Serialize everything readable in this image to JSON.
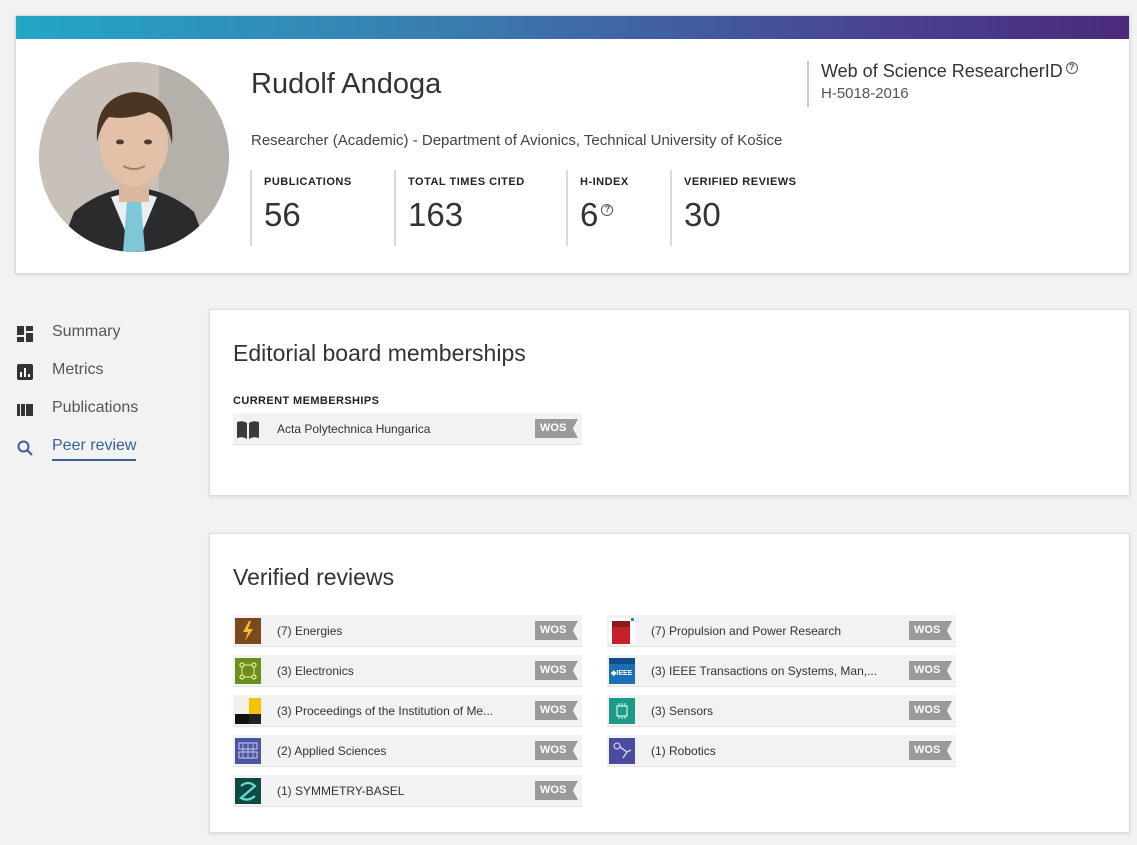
{
  "profile": {
    "name": "Rudolf Andoga",
    "affiliation": "Researcher (Academic) - Department of Avionics, Technical University of Košice",
    "researcher_id_title": "Web of Science ResearcherID",
    "researcher_id": "H-5018-2016",
    "stats": [
      {
        "label": "PUBLICATIONS",
        "value": "56"
      },
      {
        "label": "TOTAL TIMES CITED",
        "value": "163"
      },
      {
        "label": "H-INDEX",
        "value": "6"
      },
      {
        "label": "VERIFIED REVIEWS",
        "value": "30"
      }
    ],
    "colors": {
      "bar_start": "#22a7c4",
      "bar_end": "#4b2a7a",
      "accent": "#3a5f9e"
    }
  },
  "nav": {
    "items": [
      {
        "label": "Summary",
        "icon": "summary-icon"
      },
      {
        "label": "Metrics",
        "icon": "metrics-icon"
      },
      {
        "label": "Publications",
        "icon": "publications-icon"
      },
      {
        "label": "Peer review",
        "icon": "search-icon",
        "active": true
      }
    ]
  },
  "editorial": {
    "title": "Editorial board memberships",
    "section_label": "CURRENT MEMBERSHIPS",
    "items": [
      {
        "name": "Acta Polytechnica Hungarica",
        "badge": "WOS",
        "icon": "book-icon"
      }
    ]
  },
  "reviews": {
    "title": "Verified reviews",
    "left": [
      {
        "name": "(7) Energies",
        "badge": "WOS",
        "icon": "energies-cover"
      },
      {
        "name": "(3) Electronics",
        "badge": "WOS",
        "icon": "electronics-cover"
      },
      {
        "name": "(3) Proceedings of the Institution of Me...",
        "badge": "WOS",
        "icon": "proceedings-cover"
      },
      {
        "name": "(2) Applied Sciences",
        "badge": "WOS",
        "icon": "applied-sciences-cover"
      },
      {
        "name": "(1) SYMMETRY-BASEL",
        "badge": "WOS",
        "icon": "symmetry-cover"
      }
    ],
    "right": [
      {
        "name": "(7) Propulsion and Power Research",
        "badge": "WOS",
        "icon": "propulsion-cover"
      },
      {
        "name": "(3) IEEE Transactions on Systems, Man,...",
        "badge": "WOS",
        "icon": "ieee-cover"
      },
      {
        "name": "(3) Sensors",
        "badge": "WOS",
        "icon": "sensors-cover"
      },
      {
        "name": "(1) Robotics",
        "badge": "WOS",
        "icon": "robotics-cover"
      }
    ]
  }
}
